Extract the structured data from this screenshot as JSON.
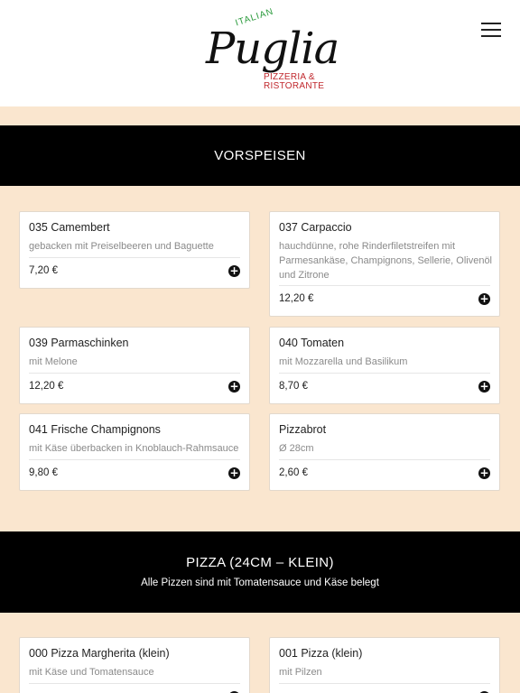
{
  "header": {
    "logo": {
      "top_text": "ITALIAN",
      "script_text": "Puglia",
      "sub_line1": "PIZZERIA &",
      "sub_line2": "RISTORANTE"
    },
    "menu_icon": "hamburger-menu-icon"
  },
  "sections": [
    {
      "title": "VORSPEISEN",
      "items": [
        {
          "title": "035 Camembert",
          "description": "gebacken mit Preiselbeeren und Baguette",
          "price": "7,20 €"
        },
        {
          "title": "037 Carpaccio",
          "description": "hauchdünne, rohe Rinderfiletstreifen mit Parmesankäse, Champignons, Sellerie, Olivenöl und Zitrone",
          "price": "12,20 €"
        },
        {
          "title": "039 Parmaschinken",
          "description": "mit Melone",
          "price": "12,20 €"
        },
        {
          "title": "040 Tomaten",
          "description": "mit Mozzarella und Basilikum",
          "price": "8,70 €"
        },
        {
          "title": "041 Frische Champignons",
          "description": "mit Käse überbacken in Knoblauch-Rahmsauce",
          "price": "9,80 €"
        },
        {
          "title": "Pizzabrot",
          "description": "Ø 28cm",
          "price": "2,60 €"
        }
      ]
    },
    {
      "title": "PIZZA (24CM – KLEIN)",
      "subtitle": "Alle Pizzen sind mit Tomatensauce und Käse belegt",
      "items": [
        {
          "title": "000 Pizza Margherita (klein)",
          "description": "mit Käse und Tomatensauce"
        },
        {
          "title": "001 Pizza (klein)",
          "description": "mit Pilzen"
        }
      ]
    }
  ],
  "add_button_symbol": "+",
  "colors": {
    "page_background": "#fae6cf",
    "section_bar": "#000000",
    "logo_green": "#2a9a3c",
    "logo_red": "#c0282d"
  }
}
